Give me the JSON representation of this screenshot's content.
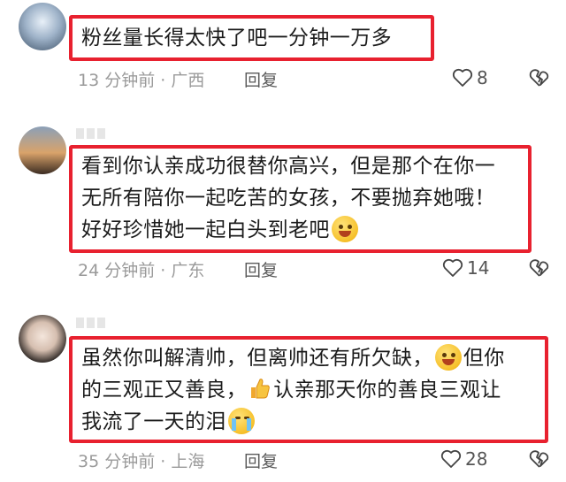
{
  "comments": [
    {
      "text_lines": [
        "粉丝量长得太快了吧一分钟一万多"
      ],
      "time": "13 分钟前",
      "location": "广西",
      "reply_label": "回复",
      "likes": "8"
    },
    {
      "text_lines": [
        "看到你认亲成功很替你高兴，但是那个在你一",
        "无所有陪你一起吃苦的女孩，不要抛弃她哦！",
        "好好珍惜她一起白头到老吧"
      ],
      "time": "24 分钟前",
      "location": "广东",
      "reply_label": "回复",
      "likes": "14"
    },
    {
      "text_lines": [
        "虽然你叫解清帅，但离帅还有所欠缺，",
        "但你",
        "的三观正又善良，",
        "认亲那天你的善良三观让",
        "我流了一天的泪"
      ],
      "time": "35 分钟前",
      "location": "上海",
      "reply_label": "回复",
      "likes": "28"
    }
  ],
  "separator": "·",
  "colors": {
    "highlight_border": "#e8212f",
    "meta_text": "#9a9a9a"
  },
  "icons": [
    "heart-outline-icon",
    "broken-heart-icon",
    "laughing-emoji",
    "thumbs-up-emoji",
    "crying-emoji"
  ]
}
